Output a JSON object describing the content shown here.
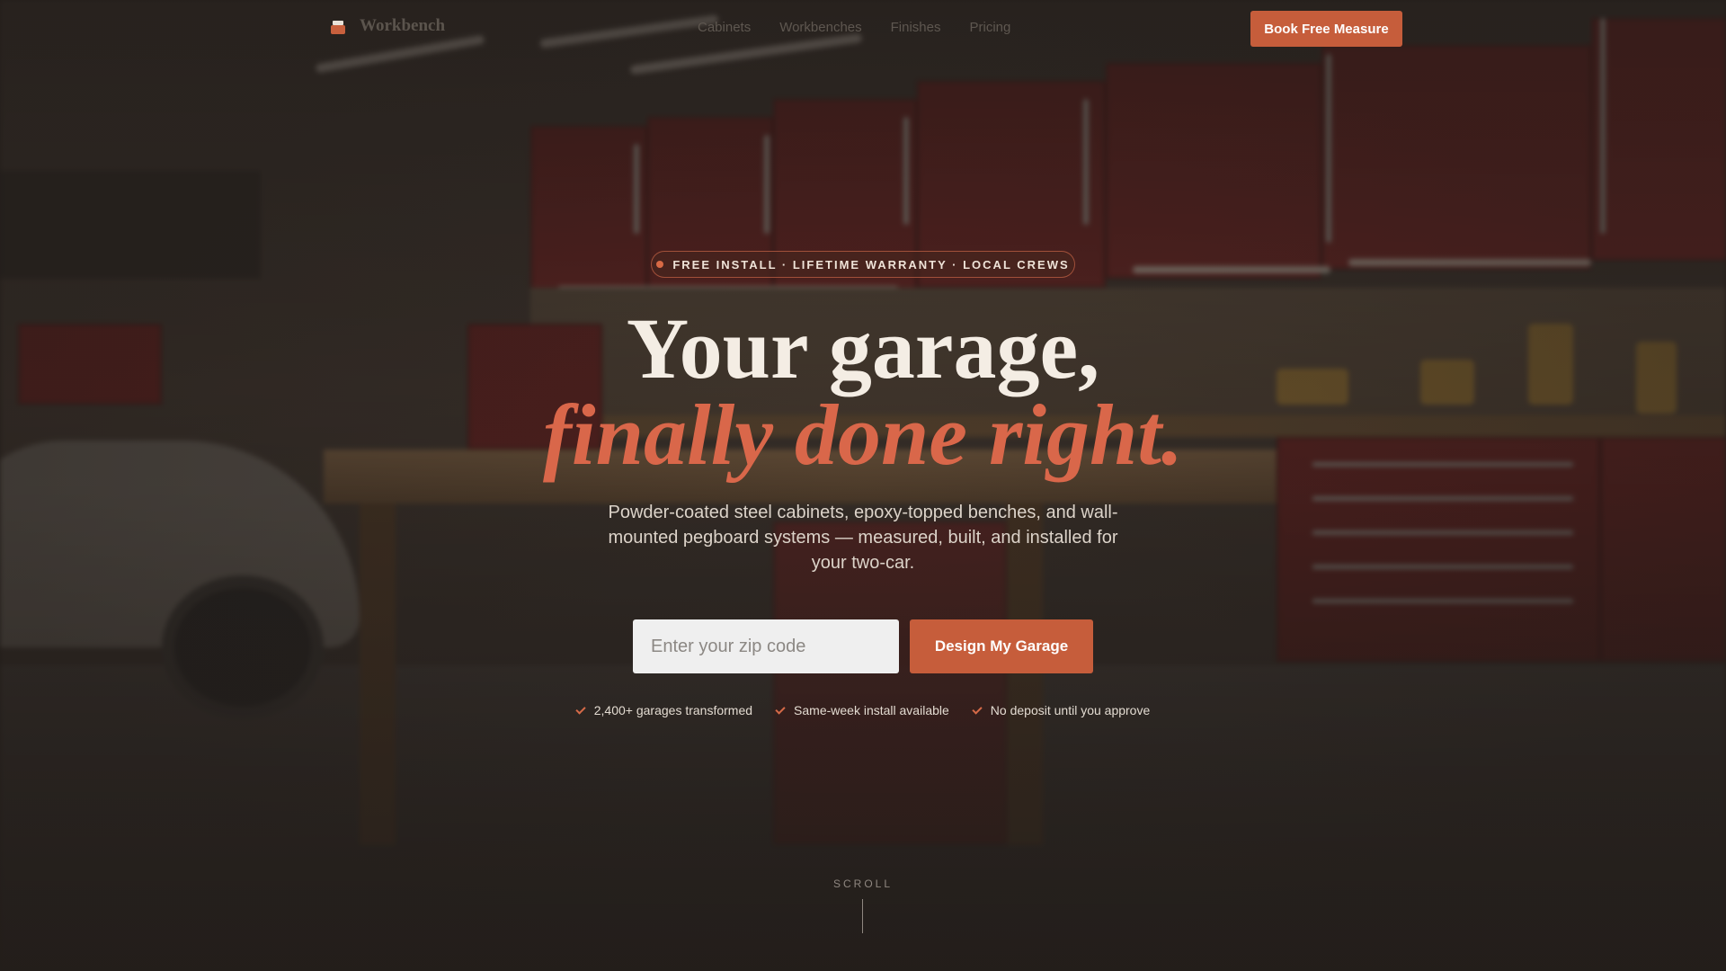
{
  "nav": {
    "brand": "Workbench",
    "links": [
      "Cabinets",
      "Workbenches",
      "Finishes",
      "Pricing"
    ],
    "cta": "Book Free Measure"
  },
  "hero": {
    "badge": "FREE INSTALL · LIFETIME WARRANTY · LOCAL CREWS",
    "headline_line1": "Your garage,",
    "headline_line2": "finally done right.",
    "subheadline": "Powder-coated steel cabinets, epoxy-topped benches, and wall-mounted pegboard systems — measured, built, and installed for your two-car.",
    "zip_placeholder": "Enter your zip code",
    "zip_value": "",
    "submit": "Design My Garage",
    "trust": [
      "2,400+ garages transformed",
      "Same-week install available",
      "No deposit until you approve"
    ],
    "scroll": "SCROLL"
  },
  "colors": {
    "accent": "#c65d3b",
    "headline_italic": "#d9674a",
    "text_light": "#f4ede4"
  },
  "icons": {
    "brand": "workbench-logo-icon",
    "trust": "check-icon"
  }
}
